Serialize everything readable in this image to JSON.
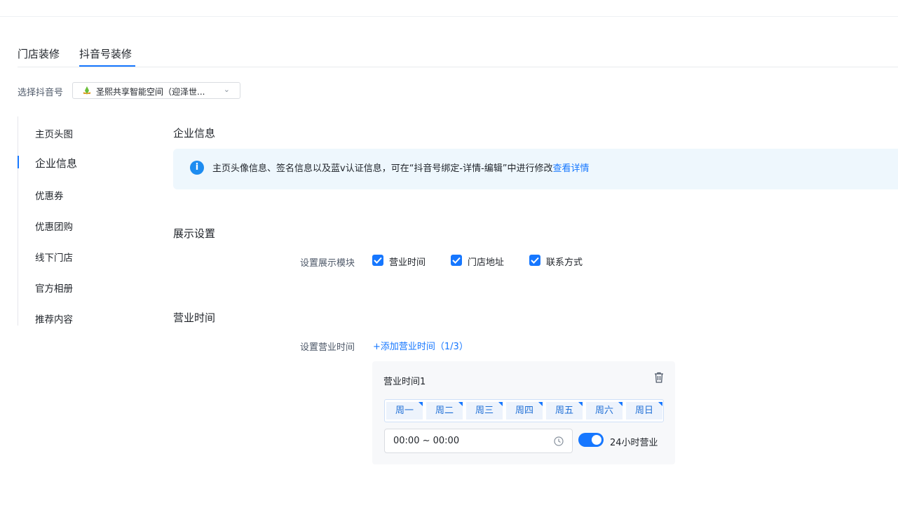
{
  "tabs": [
    {
      "label": "门店装修"
    },
    {
      "label": "抖音号装修"
    }
  ],
  "account": {
    "label": "选择抖音号",
    "value": "圣熙共享智能空间（迎泽世..."
  },
  "sidenav": {
    "items": [
      {
        "label": "主页头图"
      },
      {
        "label": "企业信息"
      },
      {
        "label": "优惠券"
      },
      {
        "label": "优惠团购"
      },
      {
        "label": "线下门店"
      },
      {
        "label": "官方相册"
      },
      {
        "label": "推荐内容"
      }
    ]
  },
  "company": {
    "title": "企业信息",
    "notice_text": "主页头像信息、签名信息以及蓝v认证信息，可在“抖音号绑定-详情-编辑”中进行修改",
    "notice_link": "查看详情"
  },
  "display": {
    "title": "展示设置",
    "label": "设置展示模块",
    "options": [
      {
        "label": "营业时间",
        "checked": true
      },
      {
        "label": "门店地址",
        "checked": true
      },
      {
        "label": "联系方式",
        "checked": true
      }
    ]
  },
  "hours": {
    "title": "营业时间",
    "label": "设置营业时间",
    "add_link": "+添加营业时间（1/3）",
    "card": {
      "title": "营业时间1",
      "days": [
        "周一",
        "周二",
        "周三",
        "周四",
        "周五",
        "周六",
        "周日"
      ],
      "time_range": "00:00 ~ 00:00",
      "toggle_label": "24小时营业",
      "toggle_on": true
    }
  },
  "colors": {
    "accent": "#1677ff",
    "notice_bg": "#eef7fd"
  }
}
